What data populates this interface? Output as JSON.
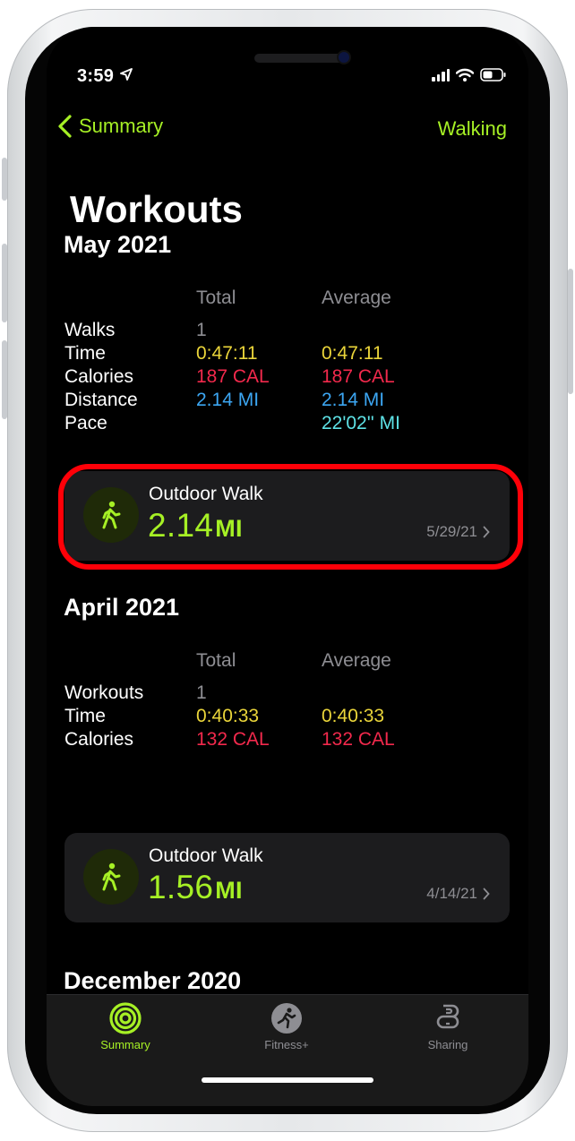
{
  "status": {
    "time": "3:59"
  },
  "nav": {
    "back_label": "Summary",
    "right_label": "Walking"
  },
  "title": "Workouts",
  "sections": [
    {
      "heading": "May 2021",
      "col_total": "Total",
      "col_average": "Average",
      "rows": [
        {
          "label": "Walks",
          "total": "1",
          "average": ""
        },
        {
          "label": "Time",
          "total": "0:47:11",
          "average": "0:47:11"
        },
        {
          "label": "Calories",
          "total": "187 CAL",
          "average": "187 CAL"
        },
        {
          "label": "Distance",
          "total": "2.14 MI",
          "average": "2.14 MI"
        },
        {
          "label": "Pace",
          "total": "",
          "average": "22'02'' MI"
        }
      ],
      "card": {
        "title": "Outdoor Walk",
        "value": "2.14",
        "unit": "MI",
        "date": "5/29/21"
      }
    },
    {
      "heading": "April 2021",
      "col_total": "Total",
      "col_average": "Average",
      "rows": [
        {
          "label": "Workouts",
          "total": "1",
          "average": ""
        },
        {
          "label": "Time",
          "total": "0:40:33",
          "average": "0:40:33"
        },
        {
          "label": "Calories",
          "total": "132 CAL",
          "average": "132 CAL"
        }
      ],
      "card": {
        "title": "Outdoor Walk",
        "value": "1.56",
        "unit": "MI",
        "date": "4/14/21"
      }
    },
    {
      "heading": "December 2020"
    }
  ],
  "tabs": [
    {
      "label": "Summary",
      "icon": "activity-rings-icon",
      "active": true
    },
    {
      "label": "Fitness+",
      "icon": "fitness-plus-icon",
      "active": false
    },
    {
      "label": "Sharing",
      "icon": "sharing-icon",
      "active": false
    }
  ],
  "colors": {
    "accent": "#a6f025",
    "highlight_ring": "#ff0008",
    "time": "#ead53a",
    "calories": "#f2294c",
    "distance": "#3ca6f2",
    "pace": "#5ee2e6"
  }
}
